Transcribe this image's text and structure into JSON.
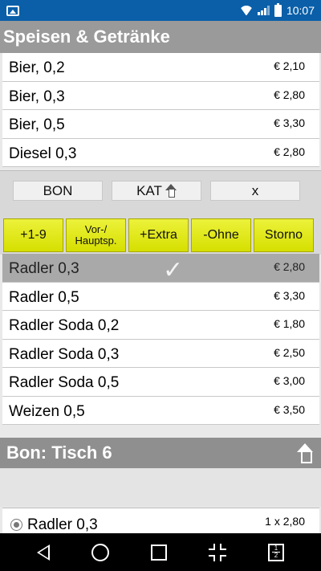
{
  "status_bar": {
    "time": "10:07",
    "icons": [
      "image-icon",
      "wifi-icon",
      "signal-icon",
      "battery-icon"
    ]
  },
  "header": {
    "title": "Speisen & Getränke"
  },
  "items_top": [
    {
      "name": "Bier, 0,2",
      "price": "€ 2,10"
    },
    {
      "name": "Bier, 0,3",
      "price": "€ 2,80"
    },
    {
      "name": "Bier, 0,5",
      "price": "€ 3,30"
    },
    {
      "name": "Diesel 0,3",
      "price": "€ 2,80"
    }
  ],
  "actions": {
    "bon_label": "BON",
    "kat_label": "KAT",
    "close_label": "x",
    "plus19_label": "+1-9",
    "vorhaupt_line1": "Vor-/",
    "vorhaupt_line2": "Hauptsp.",
    "extra_label": "+Extra",
    "ohne_label": "-Ohne",
    "storno_label": "Storno"
  },
  "items_bottom": [
    {
      "name": "Radler 0,3",
      "price": "€ 2,80",
      "selected": true
    },
    {
      "name": "Radler 0,5",
      "price": "€ 3,30"
    },
    {
      "name": "Radler Soda 0,2",
      "price": "€ 1,80"
    },
    {
      "name": "Radler Soda 0,3",
      "price": "€ 2,50"
    },
    {
      "name": "Radler Soda 0,5",
      "price": "€ 3,00"
    },
    {
      "name": "Weizen 0,5",
      "price": "€ 3,50"
    }
  ],
  "bon": {
    "title": "Bon: Tisch 6",
    "entry": {
      "name": "Radler 0,3",
      "qty_price": "1 x   2,80"
    }
  },
  "colors": {
    "status_bar": "#0a5fa8",
    "header": "#9a9a9a",
    "action_yellow": "#e2e81a",
    "selected_row": "#a9a9a9"
  }
}
